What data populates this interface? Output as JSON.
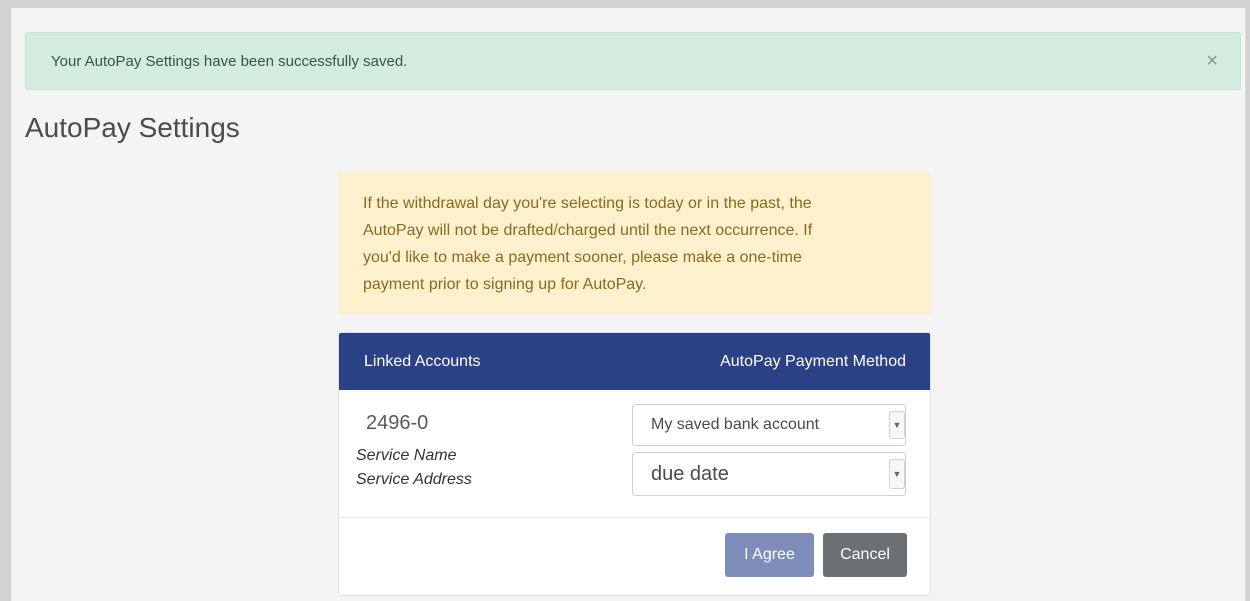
{
  "alert": {
    "message": "Your AutoPay Settings have been successfully saved.",
    "close_glyph": "×"
  },
  "page": {
    "title": "AutoPay Settings"
  },
  "warning": {
    "lines": [
      "If the withdrawal day you're selecting is today or in the past, the",
      "AutoPay will not be drafted/charged until the next occurrence. If",
      "you'd like to make a payment sooner, please make a one-time",
      "payment prior to signing up for AutoPay."
    ]
  },
  "card": {
    "header_left": "Linked Accounts",
    "header_right": "AutoPay Payment Method",
    "account_number": "2496-0",
    "service_name": "Service Name",
    "service_address": "Service Address",
    "payment_method_selected": "My saved bank account",
    "withdrawal_day_selected": "due date",
    "agree_label": "I Agree",
    "cancel_label": "Cancel"
  },
  "icons": {
    "close": "close-icon",
    "dropdown": "chevron-down-icon"
  },
  "colors": {
    "success_bg": "#d4ecdf",
    "warning_bg": "#fdf0cd",
    "header_bg": "#2b4186",
    "agree_bg": "#7e8cbc",
    "cancel_bg": "#6b7075"
  }
}
